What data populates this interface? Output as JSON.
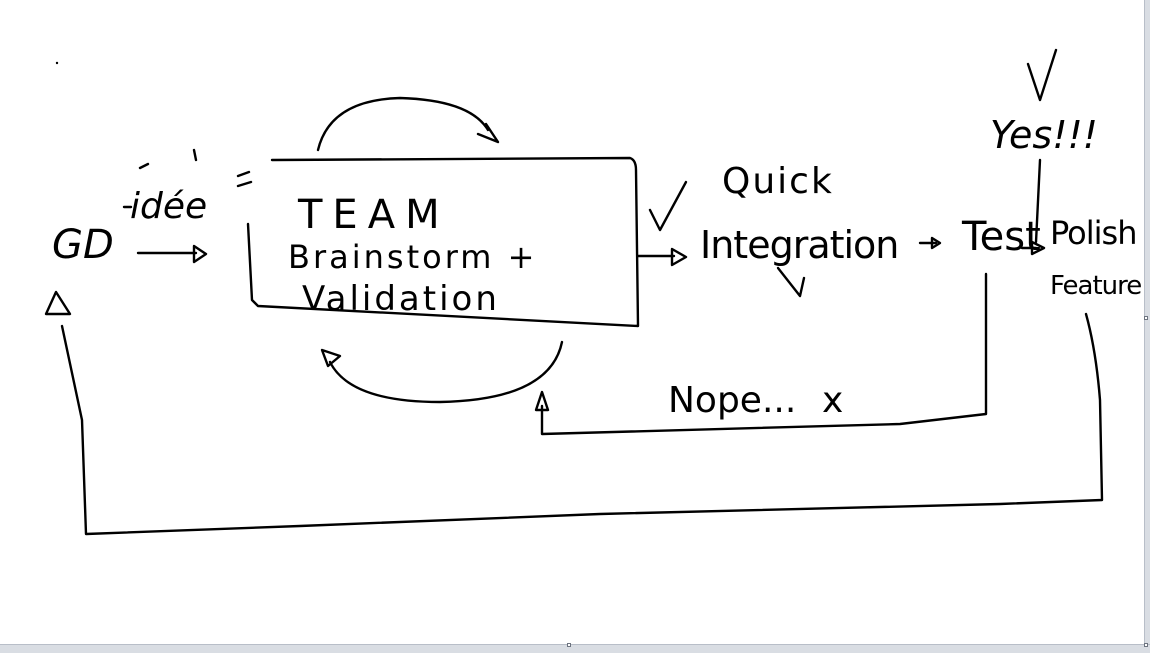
{
  "colors": {
    "ink": "#000000",
    "canvas": "#ffffff",
    "border": "#d9dde3"
  },
  "diagram": {
    "start_node": "GD",
    "idea_label": "idée",
    "team_box": {
      "title": "TEAM",
      "line1": "Brainstorm +",
      "line2": "Validation"
    },
    "quick_label": "Quick",
    "integration_label": "Integration",
    "test_label": "Test",
    "yes_label": "Yes!!!",
    "polish_line1": "Polish",
    "polish_line2": "Feature",
    "nope_label": "Nope...",
    "nope_mark": "x"
  }
}
